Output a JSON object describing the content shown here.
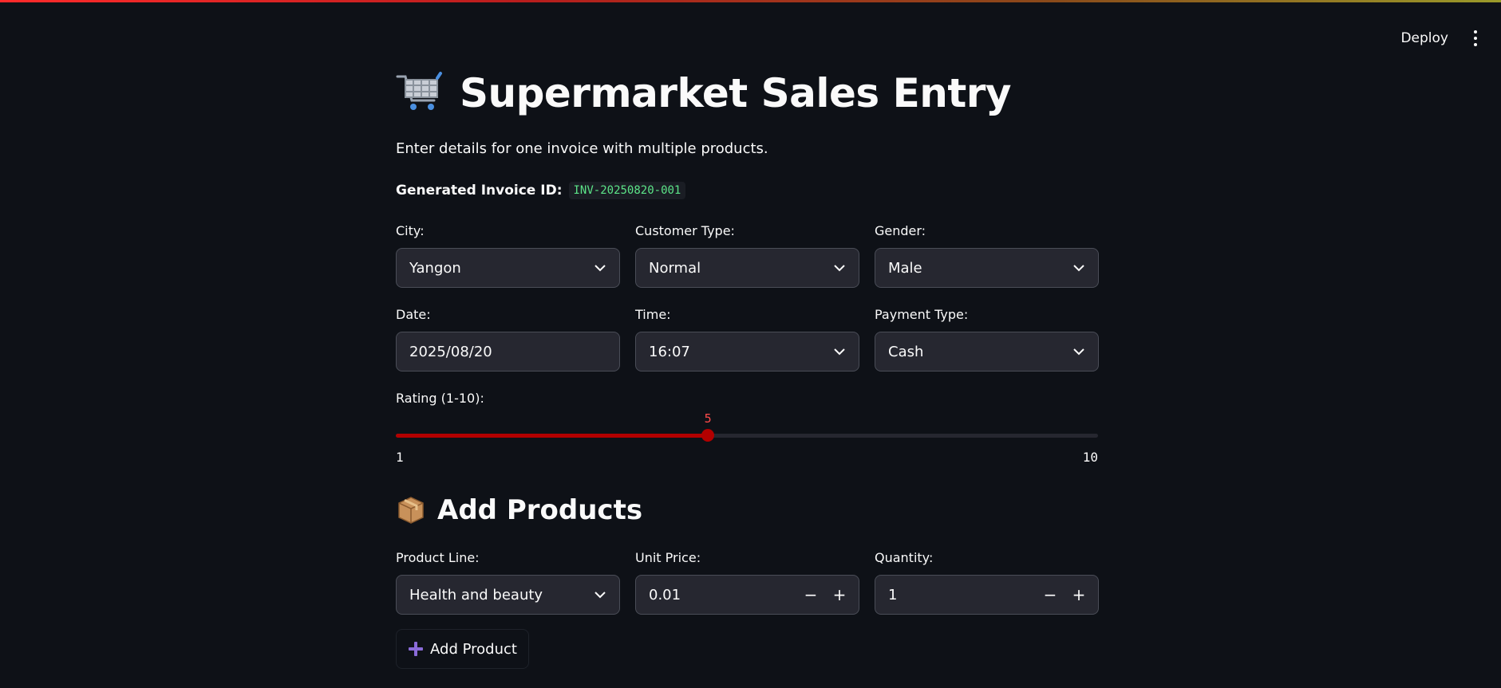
{
  "header": {
    "deploy_label": "Deploy"
  },
  "page": {
    "title": "Supermarket Sales Entry",
    "subtitle": "Enter details for one invoice with multiple products.",
    "invoice_label": "Generated Invoice ID:",
    "invoice_id": "INV-20250820-001"
  },
  "fields": {
    "city": {
      "label": "City:",
      "value": "Yangon"
    },
    "customer_type": {
      "label": "Customer Type:",
      "value": "Normal"
    },
    "gender": {
      "label": "Gender:",
      "value": "Male"
    },
    "date": {
      "label": "Date:",
      "value": "2025/08/20"
    },
    "time": {
      "label": "Time:",
      "value": "16:07"
    },
    "payment_type": {
      "label": "Payment Type:",
      "value": "Cash"
    }
  },
  "rating": {
    "label": "Rating (1-10):",
    "value": 5,
    "min": 1,
    "max": 10,
    "value_text": "5",
    "min_text": "1",
    "max_text": "10"
  },
  "products": {
    "section_title": "Add Products",
    "product_line": {
      "label": "Product Line:",
      "value": "Health and beauty"
    },
    "unit_price": {
      "label": "Unit Price:",
      "value": "0.01"
    },
    "quantity": {
      "label": "Quantity:",
      "value": "1"
    },
    "add_button_label": "Add Product"
  },
  "colors": {
    "background": "#0e1117",
    "accent": "#b20000",
    "slider_value": "#ff4b4b",
    "code_text": "#5ce488",
    "plus_icon": "#8a6bd8"
  },
  "icons": {
    "title": "shopping-cart-icon",
    "section": "package-icon",
    "add": "plus-icon"
  }
}
